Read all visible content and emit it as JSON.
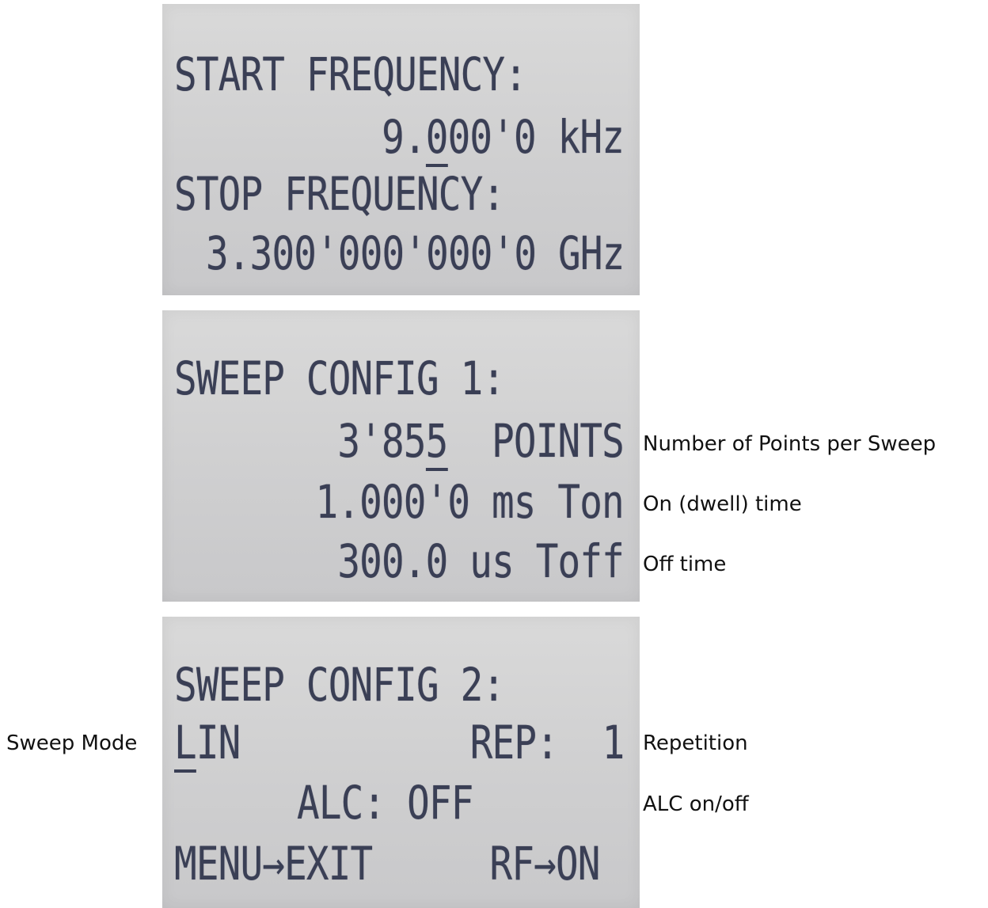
{
  "screens": {
    "start_stop": {
      "line1": "START FREQUENCY:",
      "start_value": {
        "before_cursor": "9.",
        "cursor_char": "0",
        "after_cursor": "00'0 kHz"
      },
      "line3": "STOP FREQUENCY:",
      "stop_value": "3.300'000'000'0 GHz"
    },
    "sweep_config_1": {
      "title": "SWEEP CONFIG 1:",
      "points": {
        "before_cursor": "3'85",
        "cursor_char": "5",
        "after_cursor": "  POINTS"
      },
      "on_time": "1.000'0 ms Ton",
      "off_time": "300.0 us Toff"
    },
    "sweep_config_2": {
      "title": "SWEEP CONFIG 2:",
      "mode": {
        "cursor_char": "L",
        "after_cursor": "IN"
      },
      "repetition": "REP:  1",
      "alc": "ALC: OFF",
      "menu_hint": "MENU→EXIT",
      "rf_hint": "RF→ON"
    }
  },
  "annotations": {
    "points_per_sweep": "Number of Points per Sweep",
    "on_time": "On (dwell) time",
    "off_time": "Off time",
    "sweep_mode": "Sweep Mode",
    "repetition": "Repetition",
    "alc": "ALC on/off"
  }
}
